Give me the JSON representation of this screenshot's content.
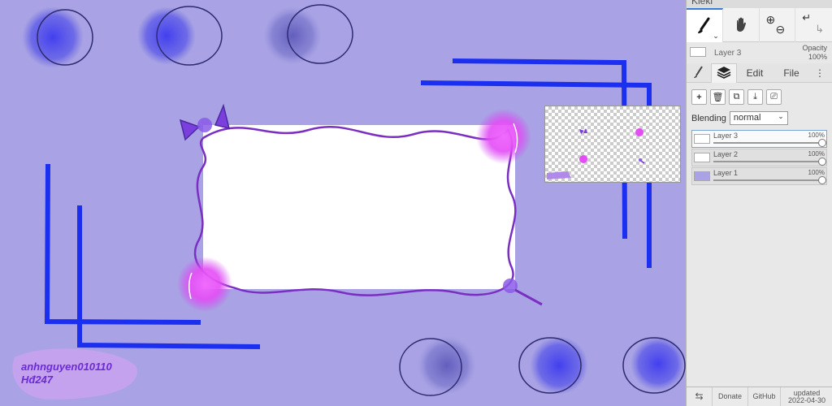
{
  "app": {
    "name": "Kleki"
  },
  "canvas": {
    "watermark_line1": "anhnguyen010110",
    "watermark_line2": "Hđ247",
    "colors": {
      "background": "#a9a3e5",
      "accent_purple": "#7b2fc2",
      "blue": "#1a2ff0",
      "glow": "#e040fb"
    }
  },
  "toolbar": {
    "brush_icon": "brush-icon",
    "hand_icon": "hand-icon",
    "zoom_in_icon": "zoom-in-icon",
    "zoom_out_icon": "zoom-out-icon",
    "undo_icon": "undo-icon",
    "redo_icon": "redo-icon"
  },
  "current_layer": {
    "name": "Layer 3",
    "opacity_label": "Opacity",
    "opacity_value": "100%"
  },
  "tabs": [
    {
      "label": "",
      "icon": "brush-tab-icon"
    },
    {
      "label": "",
      "icon": "layers-icon"
    },
    {
      "label": "Edit"
    },
    {
      "label": "File"
    }
  ],
  "layer_actions": [
    "add-layer-icon",
    "delete-layer-icon",
    "duplicate-layer-icon",
    "merge-down-icon",
    "rename-layer-icon"
  ],
  "blending": {
    "label": "Blending",
    "value": "normal"
  },
  "layers": [
    {
      "name": "Layer 3",
      "opacity": "100%",
      "active": true
    },
    {
      "name": "Layer 2",
      "opacity": "100%",
      "active": false
    },
    {
      "name": "Layer 1",
      "opacity": "100%",
      "active": false
    }
  ],
  "footer": {
    "donate": "Donate",
    "github": "GitHub",
    "updated_label": "updated",
    "updated_date": "2022-04-30"
  }
}
